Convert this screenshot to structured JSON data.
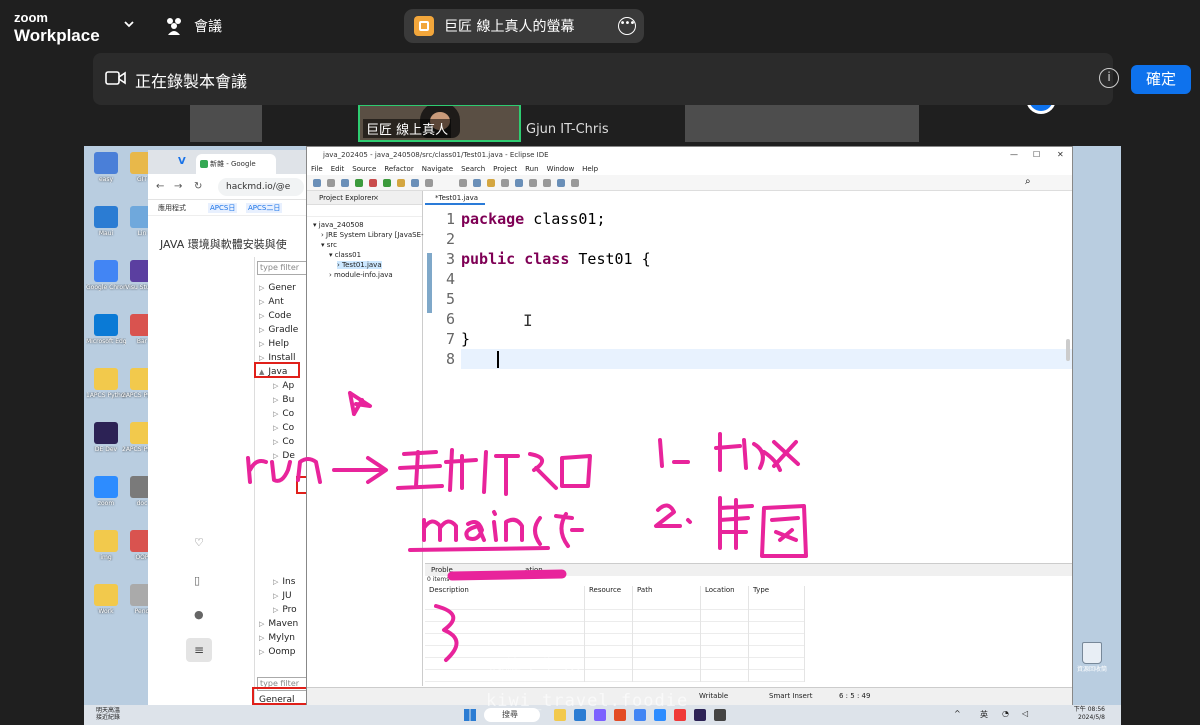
{
  "zoom": {
    "brand_line1": "zoom",
    "brand_line2": "Workplace",
    "meeting_label": "會議",
    "share_title": "巨匠 線上真人的螢幕"
  },
  "banner": {
    "recording_text": "正在錄製本會議",
    "info_icon": "i",
    "ok_button": "確定"
  },
  "participants": {
    "tile_name": "巨匠 線上真人",
    "other_name": "Gjun IT-Chris"
  },
  "browser": {
    "tab_title": "新雜 - Google",
    "url": "hackmd.io/@e",
    "bookmarks": [
      "應用程式",
      "APCS日",
      "APCS二日"
    ],
    "doc_title": "JAVA 環境與軟體安裝與使",
    "pref_filter": "type filter",
    "pref_filter_bottom": "type filter",
    "pref_items": [
      "Gener",
      "Ant",
      "Code",
      "Gradle",
      "Help",
      "Install",
      "Java",
      "Ap",
      "Bu",
      "Co",
      "Co",
      "Co",
      "De",
      "Ins",
      "JU",
      "Pro",
      "Maven",
      "Mylyn",
      "Oomp"
    ],
    "pref_general": "General"
  },
  "eclipse": {
    "title": "java_202405 - java_240508/src/class01/Test01.java - Eclipse IDE",
    "menu": [
      "File",
      "Edit",
      "Source",
      "Refactor",
      "Navigate",
      "Search",
      "Project",
      "Run",
      "Window",
      "Help"
    ],
    "explorer_title": "Project Explorer",
    "tree": [
      "java_240508",
      "JRE System Library [JavaSE-",
      "src",
      "class01",
      "Test01.java",
      "module-info.java"
    ],
    "editor_tab": "*Test01.java",
    "code": [
      {
        "n": "1",
        "kw": "package",
        "rest": " class01;"
      },
      {
        "n": "2",
        "kw": "",
        "rest": ""
      },
      {
        "n": "3",
        "kw": "public class",
        "rest": " Test01 {"
      },
      {
        "n": "4",
        "kw": "",
        "rest": ""
      },
      {
        "n": "5",
        "kw": "",
        "rest": ""
      },
      {
        "n": "6",
        "kw": "",
        "rest": ""
      },
      {
        "n": "7",
        "kw": "",
        "rest": "}"
      },
      {
        "n": "8",
        "kw": "",
        "rest": ""
      }
    ],
    "problems_tab": "Proble",
    "problems_tab_end": "ation",
    "problems_count": "0 items",
    "problem_columns": [
      "Description",
      "Resource",
      "Path",
      "Location",
      "Type"
    ],
    "status": {
      "writable": "Writable",
      "mode": "Smart Insert",
      "position": "6 : 5 : 49"
    }
  },
  "desktop": {
    "icons": [
      "easy",
      "GIT",
      "Maui",
      "Lin",
      "Google Chrome",
      "Visu Studio",
      "Microsoft Edge",
      "Bar",
      "1APCS Python",
      "2APCS Python",
      "DE Dev",
      "2APCS Python",
      "zoom",
      "doc",
      "img",
      "OOP",
      "Work",
      "Pend"
    ],
    "recycle": "資源回收筒"
  },
  "taskbar": {
    "weather_line1": "明天高溫",
    "weather_line2": "接近紀錄",
    "search": "搜尋",
    "ime": "英",
    "time_line1": "下午 08:56",
    "time_line2": "2024/5/8"
  },
  "watermarks": {
    "line1": "冠緯 | 生 ...",
    "line2": "kiwi_travel.foodie"
  },
  "colors": {
    "zoom_blue": "#0e72ed",
    "active_speaker": "#2ecc71",
    "ink": "#e8249b",
    "java_keyword": "#7f0055"
  }
}
